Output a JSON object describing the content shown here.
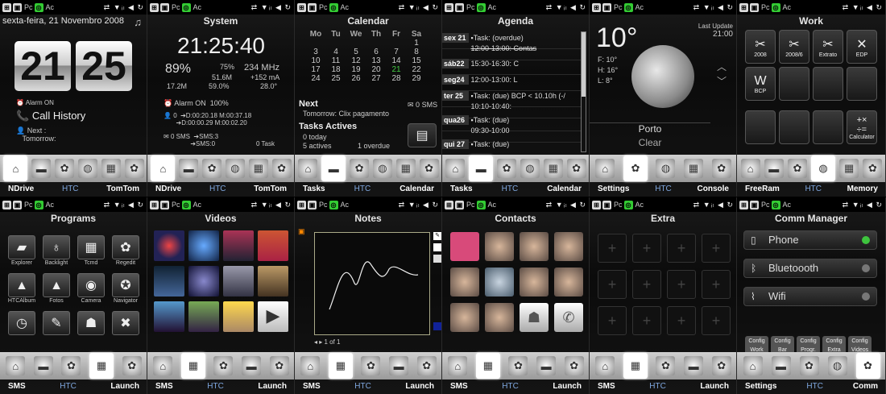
{
  "statusbar": {
    "app1": "Pc",
    "app2": "Ac",
    "icons": "⇄ ▼ᵢₗ ◀ ↻"
  },
  "top": [
    {
      "title": "sexta-feira, 21 Novembro 2008",
      "hour": "21",
      "minute": "25",
      "alarm": "Alarm ON",
      "call_history": "Call History",
      "next_label": "Next :",
      "next_value": "Tomorrow:",
      "nav": {
        "left": "NDrive",
        "mid": "HTC",
        "right": "TomTom"
      }
    },
    {
      "title": "System",
      "clock": "21:25:40",
      "cpu": "89%",
      "bat": "75%",
      "mhz": "234 MHz",
      "mem1": "51.6M",
      "ma": "+152 mA",
      "mem2": "17.2M",
      "mem3": "59.0%",
      "temp": "28.0°",
      "alarm": "Alarm ON",
      "bat2": "100%",
      "dur1": "D:00:20.18",
      "m1": "M:00:37.18",
      "dur2": "D:00:00.29",
      "m2": "M:00:02.20",
      "sms_count": "0",
      "sms_label": "SMS",
      "sms1": "SMS:3",
      "sms2": "SMS:0",
      "task": "0 Task",
      "zero": "0",
      "nav": {
        "left": "NDrive",
        "mid": "HTC",
        "right": "TomTom"
      }
    },
    {
      "title": "Calendar",
      "days": [
        "Mo",
        "Tu",
        "We",
        "Th",
        "Fr",
        "Sa"
      ],
      "weeks": [
        [
          "",
          "",
          "",
          "",
          "",
          "1"
        ],
        [
          "3",
          "4",
          "5",
          "6",
          "7",
          "8"
        ],
        [
          "10",
          "11",
          "12",
          "13",
          "14",
          "15"
        ],
        [
          "17",
          "18",
          "19",
          "20",
          "21",
          "22"
        ],
        [
          "24",
          "25",
          "26",
          "27",
          "28",
          "29"
        ]
      ],
      "next_label": "Next",
      "next_value": "Tomorrow: Clix pagamento",
      "sms_count": "0",
      "sms_label": "SMS",
      "tasks_label": "Tasks Actives",
      "today": "0 today",
      "actives": "5 actives",
      "overdue": "1 overdue",
      "nav": {
        "left": "Tasks",
        "mid": "HTC",
        "right": "Calendar"
      }
    },
    {
      "title": "Agenda",
      "rows": [
        {
          "day": "sex 21",
          "text": "▪Task: (overdue)"
        },
        {
          "day": "",
          "text": "12:00-13:00: Contas"
        },
        {
          "day": "sáb22",
          "text": "15:30-16:30: C"
        },
        {
          "day": "seg24",
          "text": "12:00-13:00: L"
        },
        {
          "day": "ter 25",
          "text": "▪Task: (due) BCP < 10.10h (-/"
        },
        {
          "day": "",
          "text": "10:10-10:40:"
        },
        {
          "day": "qua26",
          "text": "▪Task: (due)"
        },
        {
          "day": "",
          "text": "09:30-10:00"
        },
        {
          "day": "qui 27",
          "text": "▪Task: (due)"
        }
      ],
      "nav": {
        "left": "Tasks",
        "mid": "HTC",
        "right": "Calendar"
      }
    },
    {
      "title": "",
      "temp": "10°",
      "last_update": "Last Update",
      "update_time": "21:00",
      "f": "F: 10°",
      "h": "H: 16°",
      "l": "L: 8°",
      "city": "Porto",
      "cond": "Clear",
      "nav": {
        "left": "Settings",
        "mid": "HTC",
        "right": "Console"
      }
    },
    {
      "title": "Work",
      "apps": [
        "2008",
        "2008/6",
        "Extrato",
        "EDP",
        "BCP"
      ],
      "calc": "Calculator",
      "nav": {
        "left": "FreeRam",
        "mid": "HTC",
        "right": "Memory"
      }
    }
  ],
  "bottom": [
    {
      "title": "Programs",
      "apps": [
        "Explorer",
        "Backlight",
        "Tcmd",
        "Regedit",
        "HTCAlbum",
        "Fotos",
        "Camera",
        "Navigator"
      ],
      "nav": {
        "left": "SMS",
        "mid": "HTC",
        "right": "Launch"
      }
    },
    {
      "title": "Videos",
      "nav": {
        "left": "SMS",
        "mid": "HTC",
        "right": "Launch"
      }
    },
    {
      "title": "Notes",
      "page": "1 of 1",
      "nav": {
        "left": "SMS",
        "mid": "HTC",
        "right": "Launch"
      }
    },
    {
      "title": "Contacts",
      "nav": {
        "left": "SMS",
        "mid": "HTC",
        "right": "Launch"
      }
    },
    {
      "title": "Extra",
      "nav": {
        "left": "SMS",
        "mid": "HTC",
        "right": "Launch"
      }
    },
    {
      "title": "Comm Manager",
      "items": [
        {
          "name": "Phone",
          "color": "#3ec43e"
        },
        {
          "name": "Bluetoooth",
          "color": "#888888"
        },
        {
          "name": "Wifi",
          "color": "#888888"
        }
      ],
      "config": [
        "Config Work",
        "Config Bar",
        "Config Progr.",
        "Config Extra",
        "Config Videos"
      ],
      "nav": {
        "left": "Settings",
        "mid": "HTC",
        "right": "Comm"
      }
    }
  ]
}
